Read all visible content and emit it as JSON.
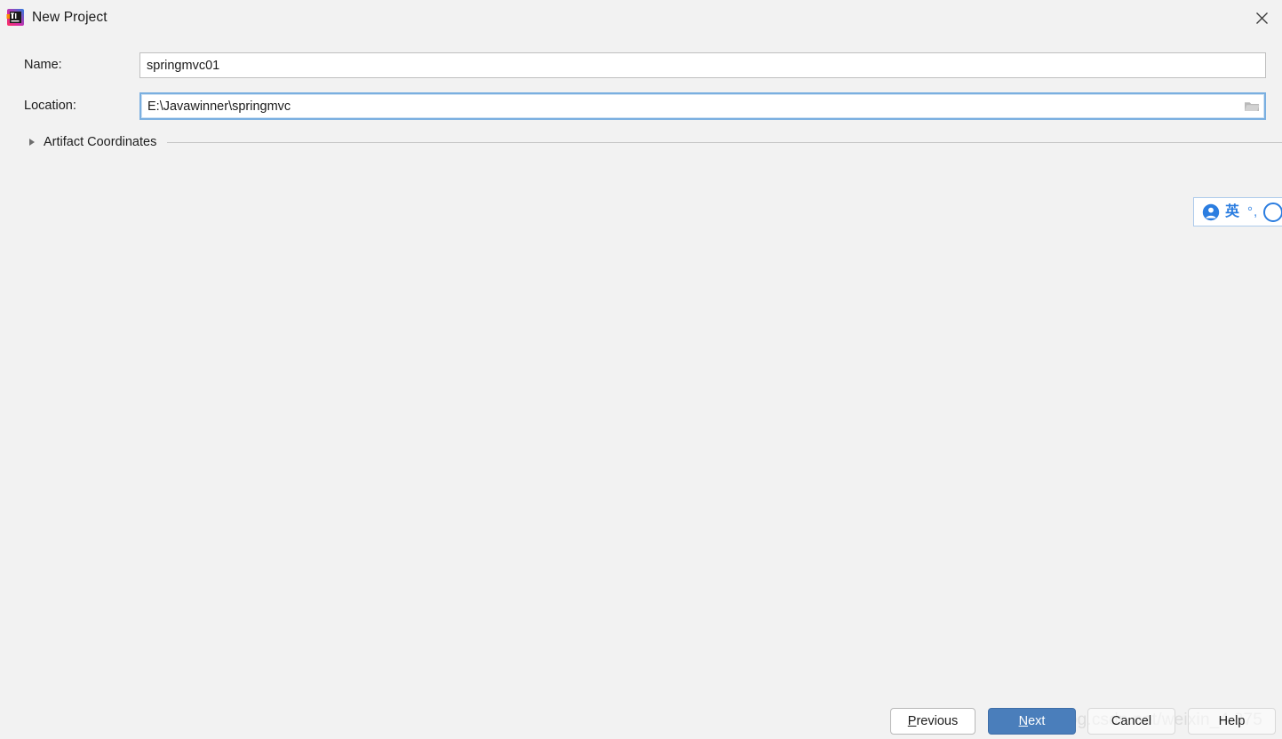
{
  "window": {
    "title": "New Project",
    "app_icon": "intellij-idea-icon",
    "close_icon": "close-icon",
    "background_color": "#f2f2f2"
  },
  "form": {
    "name_row": {
      "label": "Name:",
      "value": "springmvc01",
      "placeholder": ""
    },
    "location_row": {
      "label": "Location:",
      "value": "E:\\Javawinner\\springmvc",
      "placeholder": "",
      "browse_icon": "folder-icon",
      "focused": true,
      "focus_color": "#7aafe0"
    },
    "artifact_section": {
      "label": "Artifact Coordinates",
      "expanded": false,
      "chevron_icon": "triangle-right-icon"
    }
  },
  "ime_toolbar": {
    "avatar_icon": "user-avatar-icon",
    "language": "英",
    "punctuation": "°,",
    "accent_color": "#2b7de0"
  },
  "watermark": {
    "text": "https://blog.csdn.net/weixin_4    875"
  },
  "buttons": {
    "previous": {
      "prefix": "",
      "mnemonic": "P",
      "suffix": "revious"
    },
    "next": {
      "prefix": "",
      "mnemonic": "N",
      "suffix": "ext"
    },
    "cancel": {
      "prefix": "",
      "mnemonic": "C",
      "suffix": "ancel"
    },
    "help": {
      "prefix": "",
      "mnemonic": "H",
      "suffix": "elp"
    },
    "primary_color": "#4a7ebb"
  }
}
